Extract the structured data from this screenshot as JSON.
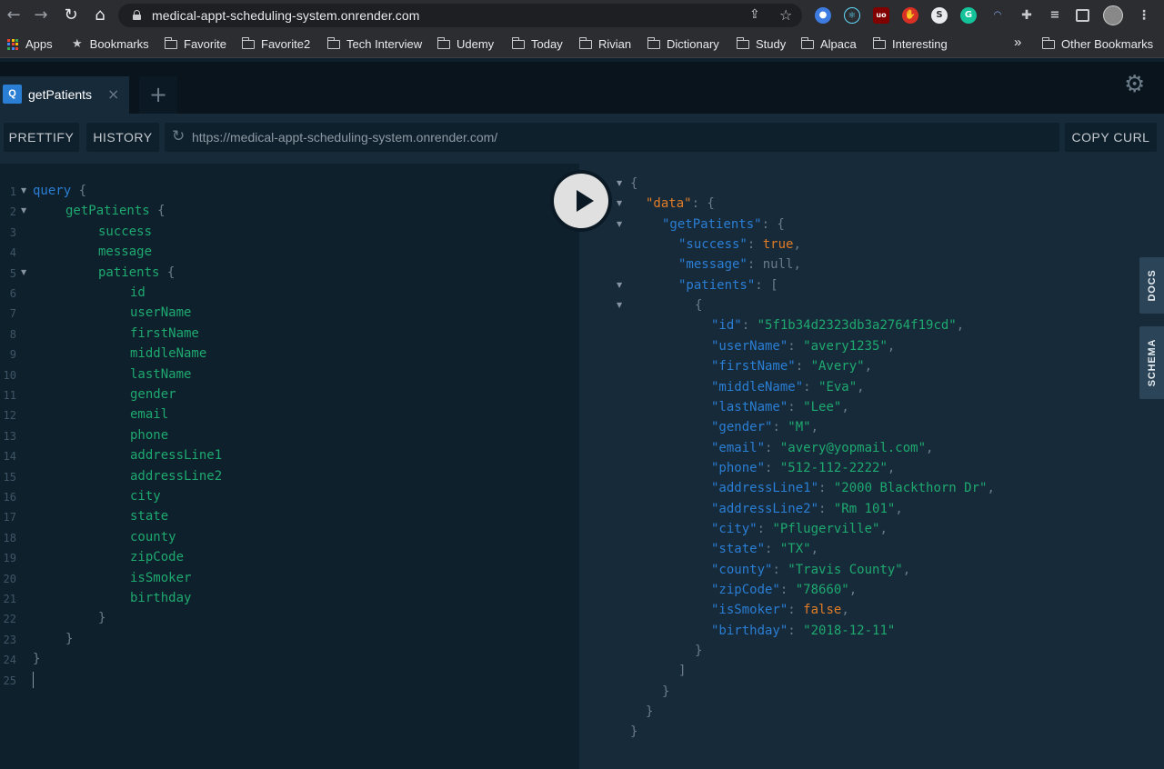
{
  "browser": {
    "url": "medical-appt-scheduling-system.onrender.com",
    "bookmarks": [
      "Apps",
      "Bookmarks",
      "Favorite",
      "Favorite2",
      "Tech Interview",
      "Udemy",
      "Today",
      "Rivian",
      "Dictionary",
      "Study",
      "Alpaca",
      "Interesting"
    ],
    "other_bookmarks": "Other Bookmarks",
    "overflow": "»"
  },
  "playground": {
    "tab_badge": "Q",
    "tab_title": "getPatients",
    "tab_close": "×",
    "tab_add": "+",
    "prettify_label": "PRETTIFY",
    "history_label": "HISTORY",
    "endpoint": "https://medical-appt-scheduling-system.onrender.com/",
    "copy_curl_label": "COPY CURL",
    "docs_label": "DOCS",
    "schema_label": "SCHEMA"
  },
  "query": {
    "keyword": "query",
    "operation": "getPatients",
    "top_fields": [
      "success",
      "message"
    ],
    "list_field": "patients",
    "patient_fields": [
      "id",
      "userName",
      "firstName",
      "middleName",
      "lastName",
      "gender",
      "email",
      "phone",
      "addressLine1",
      "addressLine2",
      "city",
      "state",
      "county",
      "zipCode",
      "isSmoker",
      "birthday"
    ],
    "line_count": 25
  },
  "result": {
    "data_key": "\"data\"",
    "op_key": "\"getPatients\"",
    "success_key": "\"success\"",
    "success_value": "true",
    "message_key": "\"message\"",
    "message_value": "null",
    "patients_key": "\"patients\"",
    "patient": [
      {
        "key": "\"id\"",
        "value": "\"5f1b34d2323db3a2764f19cd\"",
        "type": "str"
      },
      {
        "key": "\"userName\"",
        "value": "\"avery1235\"",
        "type": "str"
      },
      {
        "key": "\"firstName\"",
        "value": "\"Avery\"",
        "type": "str"
      },
      {
        "key": "\"middleName\"",
        "value": "\"Eva\"",
        "type": "str"
      },
      {
        "key": "\"lastName\"",
        "value": "\"Lee\"",
        "type": "str"
      },
      {
        "key": "\"gender\"",
        "value": "\"M\"",
        "type": "str"
      },
      {
        "key": "\"email\"",
        "value": "\"avery@yopmail.com\"",
        "type": "str"
      },
      {
        "key": "\"phone\"",
        "value": "\"512-112-2222\"",
        "type": "str"
      },
      {
        "key": "\"addressLine1\"",
        "value": "\"2000 Blackthorn Dr\"",
        "type": "str"
      },
      {
        "key": "\"addressLine2\"",
        "value": "\"Rm 101\"",
        "type": "str"
      },
      {
        "key": "\"city\"",
        "value": "\"Pflugerville\"",
        "type": "str"
      },
      {
        "key": "\"state\"",
        "value": "\"TX\"",
        "type": "str"
      },
      {
        "key": "\"county\"",
        "value": "\"Travis County\"",
        "type": "str"
      },
      {
        "key": "\"zipCode\"",
        "value": "\"78660\"",
        "type": "str"
      },
      {
        "key": "\"isSmoker\"",
        "value": "false",
        "type": "lit"
      },
      {
        "key": "\"birthday\"",
        "value": "\"2018-12-11\"",
        "type": "str"
      }
    ]
  },
  "colors": {
    "pane_dark": "#0f202d",
    "pane_light": "#172a3a",
    "keyword_blue": "#2a7ed3",
    "field_green": "#1ea96f",
    "literal_orange": "#e07c25"
  }
}
